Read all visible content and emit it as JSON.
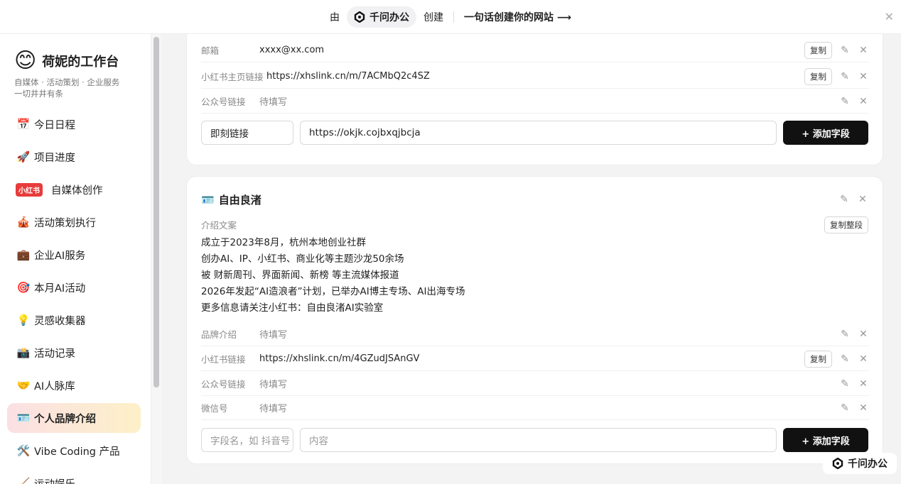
{
  "topbar": {
    "prefix": "由",
    "product": "千问办公",
    "suffix": "创建",
    "cta": "一句话创建你的网站 ⟶"
  },
  "sidebar": {
    "emoji": "😊",
    "title": "荷妮的工作台",
    "tagline1": "自媒体 · 活动策划 · 企业服务",
    "tagline2": "一切井井有条",
    "items": [
      {
        "icon": "📅",
        "label": "今日日程"
      },
      {
        "icon": "🚀",
        "label": "项目进度"
      },
      {
        "badge": "小红书",
        "label": "自媒体创作"
      },
      {
        "icon": "🎪",
        "label": "活动策划执行"
      },
      {
        "icon": "💼",
        "label": "企业AI服务"
      },
      {
        "icon": "🎯",
        "label": "本月AI活动"
      },
      {
        "icon": "💡",
        "label": "灵感收集器"
      },
      {
        "icon": "📸",
        "label": "活动记录"
      },
      {
        "icon": "🤝",
        "label": "AI人脉库"
      },
      {
        "icon": "🪪",
        "label": "个人品牌介绍"
      },
      {
        "icon": "🛠️",
        "label": "Vibe Coding 产品"
      },
      {
        "icon": "🧹",
        "label": "运动娱乐"
      }
    ]
  },
  "card1": {
    "rows": [
      {
        "label": "邮箱",
        "value": "xxxx@xx.com",
        "copy": "复制"
      },
      {
        "label": "小红书主页链接",
        "value": "https://xhslink.cn/m/7ACMbQ2c4SZ",
        "copy": "复制"
      },
      {
        "label": "公众号链接",
        "value": "待填写"
      }
    ],
    "field_name": "即刻链接",
    "field_value": "https://okjk.cojbxqjbcja",
    "add_label": "+ 添加字段"
  },
  "card2": {
    "icon": "🪪",
    "title": "自由良渚",
    "intro_label": "介绍文案",
    "copy_all": "复制整段",
    "intro_lines": [
      "成立于2023年8月，杭州本地创业社群",
      "创办AI、IP、小红书、商业化等主题沙龙50余场",
      "被 财新周刊、界面新闻、新榜 等主流媒体报道",
      "2026年发起“AI造浪者”计划，已举办AI博主专场、AI出海专场",
      "更多信息请关注小红书：自由良渚AI实验室"
    ],
    "rows": [
      {
        "label": "品牌介绍",
        "value": "待填写"
      },
      {
        "label": "小红书链接",
        "value": "https://xhslink.cn/m/4GZudJSAnGV",
        "copy": "复制"
      },
      {
        "label": "公众号链接",
        "value": "待填写"
      },
      {
        "label": "微信号",
        "value": "待填写"
      }
    ],
    "field_name_placeholder": "字段名，如 抖音号",
    "field_value_placeholder": "内容",
    "add_label": "+ 添加字段"
  },
  "watermark": "千问办公",
  "icons": {
    "edit": "✎",
    "delete": "✕",
    "close": "✕"
  }
}
